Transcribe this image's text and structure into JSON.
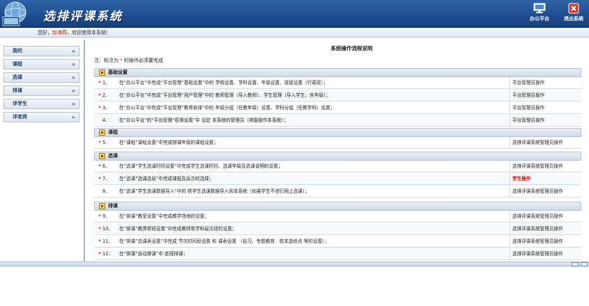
{
  "header": {
    "title": "选排评课系统",
    "buttons": [
      {
        "label": "办公平台",
        "icon": "monitor-icon"
      },
      {
        "label": "退出系统",
        "icon": "exit-icon"
      }
    ]
  },
  "welcome": {
    "prefix": "您好，",
    "user": "赵海燕",
    "suffix": "，欢迎使用本系统!"
  },
  "sidebar": {
    "items": [
      {
        "label": "我的"
      },
      {
        "label": "课程"
      },
      {
        "label": "选课"
      },
      {
        "label": "排课"
      },
      {
        "label": "评学生"
      },
      {
        "label": "评老师"
      }
    ],
    "chevron": "»"
  },
  "main": {
    "title": "系统操作流程说明",
    "note_prefix": "注：标注为",
    "note_star": "*",
    "note_suffix": "的操作必须要完成",
    "sections": [
      {
        "title": "基础设置",
        "rows": [
          {
            "star": "*",
            "num": "1、",
            "desc": "在“办公平台”中完成“平台管理”基础设置”中的 学校设置、学科设置、年级设置、班级设置（行政班）；",
            "role": "平台管理员操作",
            "red": false
          },
          {
            "star": "*",
            "num": "2、",
            "desc": "在“办公平台”中完成“平台管理”用户管理”中的 教师管理（导入教师）、学生管理（导入学生，含年级）；",
            "role": "平台管理员操作",
            "red": false
          },
          {
            "star": "*",
            "num": "3、",
            "desc": "在“办公平台”中完成“平台管理”教师安排”中的 年级分组（任教年级）设置、学科分组（任教学科）设置；",
            "role": "平台管理员操作",
            "red": false
          },
          {
            "star": "",
            "num": "4、",
            "desc": "在“办公平台”的“平台管理”权限设置”中 设定 本系统的管理员（将能操作本系统）；",
            "role": "平台管理员操作",
            "red": false
          }
        ]
      },
      {
        "title": "课程",
        "rows": [
          {
            "star": "*",
            "num": "5、",
            "desc": "在“课程”课程设置”中完成排课年级的课程设置；",
            "role": "选排评课系统管理员操作",
            "red": false
          }
        ]
      },
      {
        "title": "选课",
        "rows": [
          {
            "star": "*",
            "num": "6、",
            "desc": "在“选课”学生选课时间设置”中完成学生选课时间、选课年级及选课说明的设置；",
            "role": "选排评课系统管理员操作",
            "red": false
          },
          {
            "star": "*",
            "num": "7、",
            "desc": "在“选课”选课选层”中完成课程及层次的选择；",
            "role": "学生操作",
            "red": true
          },
          {
            "star": "",
            "num": "8、",
            "desc": "在“选课”学生选课数据导入”中的 将学生选课数据导入到本系统（如果学生不进行网上选课）；",
            "role": "选排评课系统管理员操作",
            "red": false
          }
        ]
      },
      {
        "title": "排课",
        "rows": [
          {
            "star": "*",
            "num": "9、",
            "desc": "在“排课”教室设置”中完成教学场地的设置；",
            "role": "选排评课系统管理员操作",
            "red": false
          },
          {
            "star": "*",
            "num": "10、",
            "desc": "在“排课”教师带班设置”中完成教师带学科层次班的设置；",
            "role": "选排评课系统管理员操作",
            "red": false
          },
          {
            "star": "*",
            "num": "11、",
            "desc": "在“排课”总课表设置”中完成 节次时间段设置 和 课表设置 （自习、专题教育、校本选修点 等的设置）；",
            "role": "选排评课系统管理员操作",
            "red": false
          },
          {
            "star": "*",
            "num": "12、",
            "desc": "在“排课”自动排课”中 走班排课；",
            "role": "选排评课系统管理员操作",
            "red": false
          }
        ]
      }
    ]
  },
  "colors": {
    "header_blue": "#1f4f92",
    "required_star": "#e00000",
    "student_role": "#e00000",
    "user_name": "#cc2200"
  }
}
